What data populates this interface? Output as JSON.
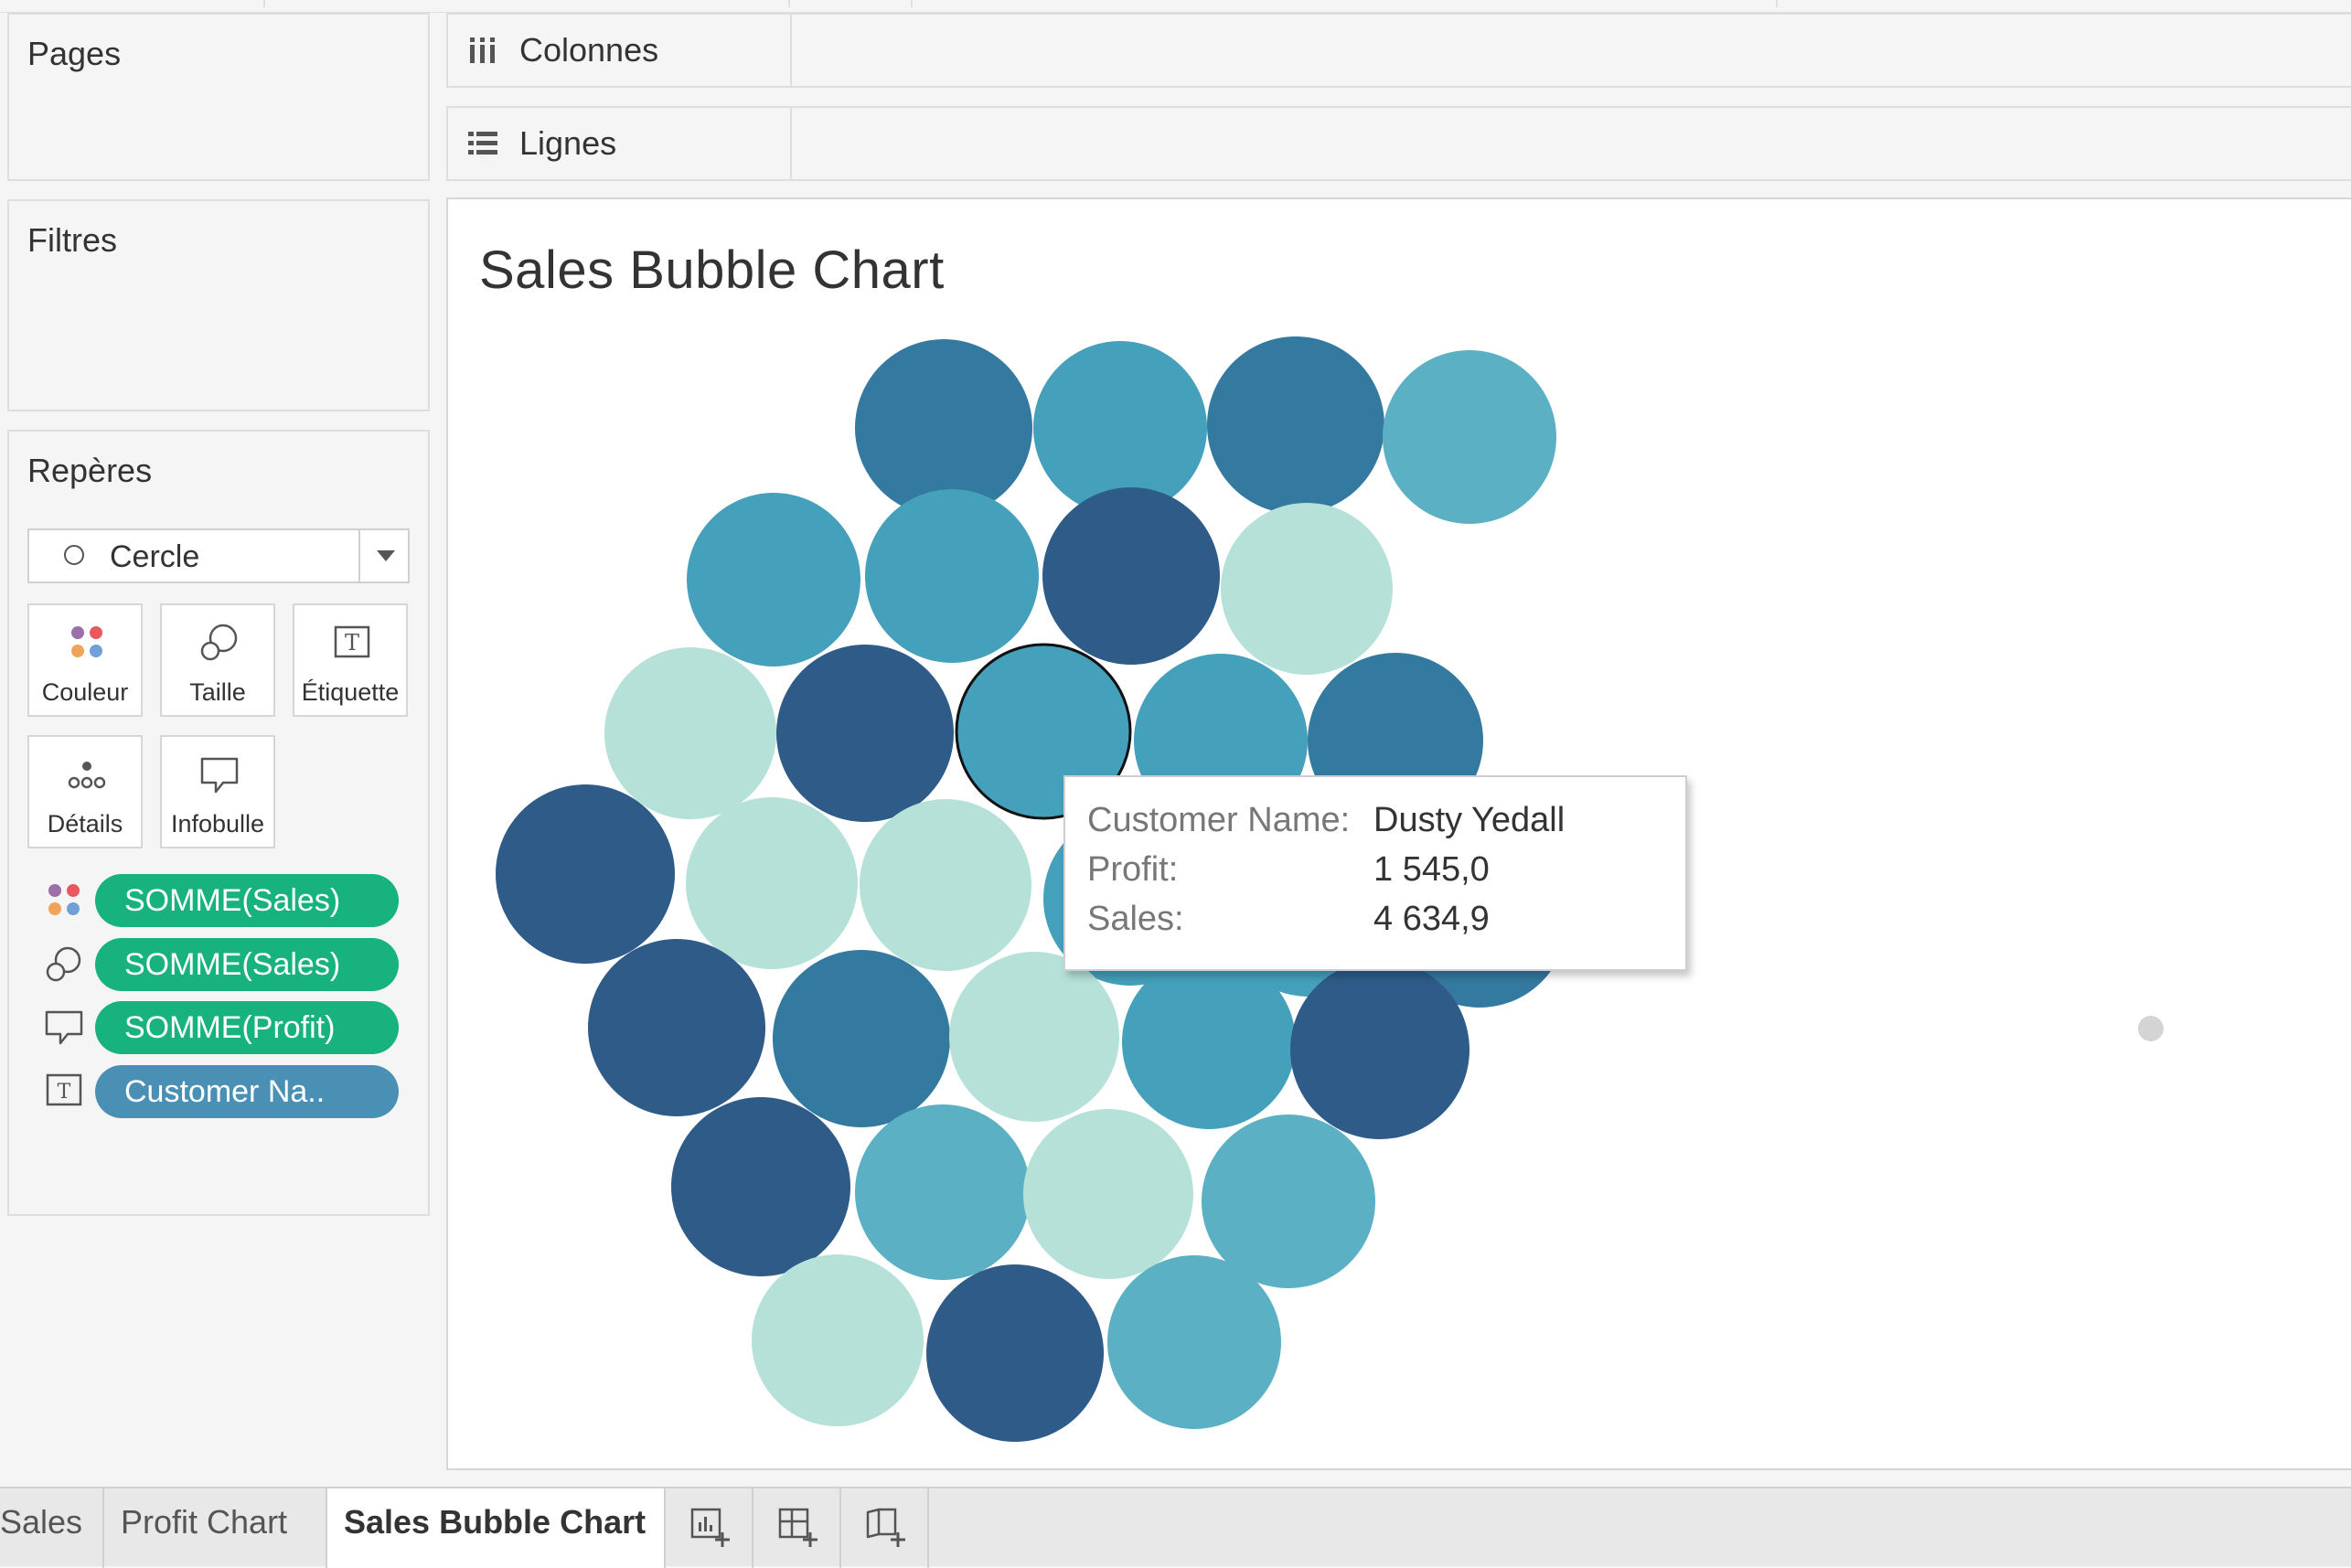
{
  "left_panel": {
    "pages_title": "Pages",
    "filters_title": "Filtres",
    "marks": {
      "title": "Repères",
      "mark_type": "Cercle",
      "buttons": [
        {
          "label": "Couleur",
          "icon": "color-dots-icon"
        },
        {
          "label": "Taille",
          "icon": "size-circles-icon"
        },
        {
          "label": "Étiquette",
          "icon": "text-label-icon"
        },
        {
          "label": "Détails",
          "icon": "detail-dots-icon"
        },
        {
          "label": "Infobulle",
          "icon": "tooltip-bubble-icon"
        }
      ],
      "fields": [
        {
          "encoding": "color",
          "icon": "color-dots-icon",
          "label": "SOMME(Sales)",
          "color": "#17b27e"
        },
        {
          "encoding": "size",
          "icon": "size-circles-icon",
          "label": "SOMME(Sales)",
          "color": "#17b27e"
        },
        {
          "encoding": "tooltip",
          "icon": "tooltip-bubble-icon",
          "label": "SOMME(Profit)",
          "color": "#17b27e"
        },
        {
          "encoding": "label",
          "icon": "text-label-icon",
          "label": "Customer Na..",
          "color": "#4a90b4"
        }
      ]
    }
  },
  "shelves": {
    "columns_label": "Colonnes",
    "rows_label": "Lignes"
  },
  "view": {
    "title": "Sales Bubble Chart"
  },
  "chart_data": {
    "type": "bubble",
    "title": "Sales Bubble Chart",
    "encodings": {
      "color": "SOMME(Sales)",
      "size": "SOMME(Sales)",
      "tooltip": "SOMME(Profit)",
      "label": "Customer Name"
    },
    "bubble_count": 37,
    "color_levels": [
      "#2e5b88",
      "#34799f",
      "#45a0bb",
      "#5bb1c3",
      "#b5e1d8"
    ],
    "highlighted": {
      "customer_name": "Dusty Yedall",
      "profit": "1 545,0",
      "sales": "4 634,9"
    }
  },
  "tooltip": {
    "rows": [
      {
        "key": "Customer Name:",
        "value": "Dusty Yedall"
      },
      {
        "key": "Profit:",
        "value": "1 545,0"
      },
      {
        "key": "Sales:",
        "value": "4 634,9"
      }
    ]
  },
  "tabs": [
    {
      "label": "Sales",
      "active": false
    },
    {
      "label": "Profit Chart",
      "active": false
    },
    {
      "label": "Sales Bubble Chart",
      "active": true
    }
  ],
  "tab_actions": [
    {
      "icon": "new-worksheet-icon"
    },
    {
      "icon": "new-dashboard-icon"
    },
    {
      "icon": "new-story-icon"
    }
  ]
}
